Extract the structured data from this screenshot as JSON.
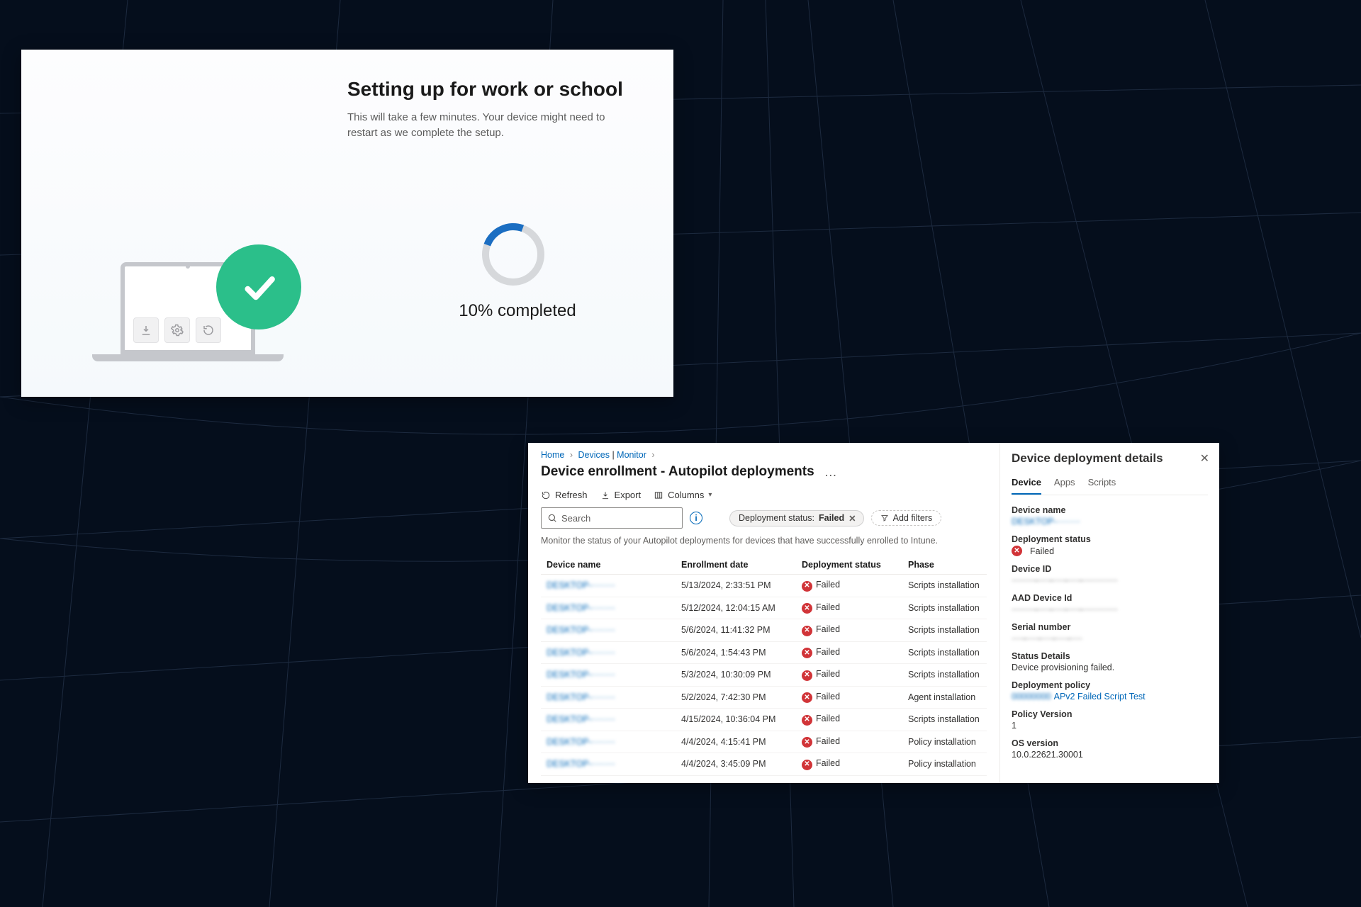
{
  "oobe": {
    "heading": "Setting up for work or school",
    "body": "This will take a few minutes. Your device might need to restart as we complete the setup.",
    "progress_percent": 10,
    "progress_text": "10% completed"
  },
  "intune": {
    "breadcrumb": {
      "home": "Home",
      "devices": "Devices",
      "monitor": "Monitor"
    },
    "sep": "›",
    "page_title": "Device enrollment - Autopilot deployments",
    "more_label": "…",
    "toolbar": {
      "refresh": "Refresh",
      "export": "Export",
      "columns": "Columns"
    },
    "search_placeholder": "Search",
    "filter_pill": {
      "label": "Deployment status:",
      "value": "Failed"
    },
    "add_filters": "Add filters",
    "hint": "Monitor the status of your Autopilot deployments for devices that have successfully enrolled to Intune.",
    "columns": {
      "device": "Device name",
      "enroll": "Enrollment date",
      "status": "Deployment status",
      "phase": "Phase"
    },
    "status_failed": "Failed",
    "rows": [
      {
        "name": "DESKTOP-········",
        "date": "5/13/2024, 2:33:51 PM",
        "phase": "Scripts installation"
      },
      {
        "name": "DESKTOP-········",
        "date": "5/12/2024, 12:04:15 AM",
        "phase": "Scripts installation"
      },
      {
        "name": "DESKTOP-········",
        "date": "5/6/2024, 11:41:32 PM",
        "phase": "Scripts installation"
      },
      {
        "name": "DESKTOP-········",
        "date": "5/6/2024, 1:54:43 PM",
        "phase": "Scripts installation"
      },
      {
        "name": "DESKTOP-········",
        "date": "5/3/2024, 10:30:09 PM",
        "phase": "Scripts installation"
      },
      {
        "name": "DESKTOP-········",
        "date": "5/2/2024, 7:42:30 PM",
        "phase": "Agent installation"
      },
      {
        "name": "DESKTOP-········",
        "date": "4/15/2024, 10:36:04 PM",
        "phase": "Scripts installation"
      },
      {
        "name": "DESKTOP-········",
        "date": "4/4/2024, 4:15:41 PM",
        "phase": "Policy installation"
      },
      {
        "name": "DESKTOP-········",
        "date": "4/4/2024, 3:45:09 PM",
        "phase": "Policy installation"
      }
    ]
  },
  "details": {
    "title": "Device deployment details",
    "tabs": {
      "device": "Device",
      "apps": "Apps",
      "scripts": "Scripts"
    },
    "fields": {
      "device_name_k": "Device name",
      "device_name_v": "DESKTOP-········",
      "status_k": "Deployment status",
      "status_v": "Failed",
      "device_id_k": "Device ID",
      "device_id_v": "········-····-····-····-············",
      "aad_id_k": "AAD Device Id",
      "aad_id_v": "········-····-····-····-············",
      "serial_k": "Serial number",
      "serial_v": "····-····-····-····-····",
      "status_det_k": "Status Details",
      "status_det_v": "Device provisioning failed.",
      "policy_k": "Deployment policy",
      "policy_v": "APv2 Failed Script Test",
      "policy_ver_k": "Policy Version",
      "policy_ver_v": "1",
      "os_k": "OS version",
      "os_v": "10.0.22621.30001"
    }
  },
  "colors": {
    "accent": "#0067b8",
    "danger": "#d13438",
    "success": "#2bbf8a"
  }
}
